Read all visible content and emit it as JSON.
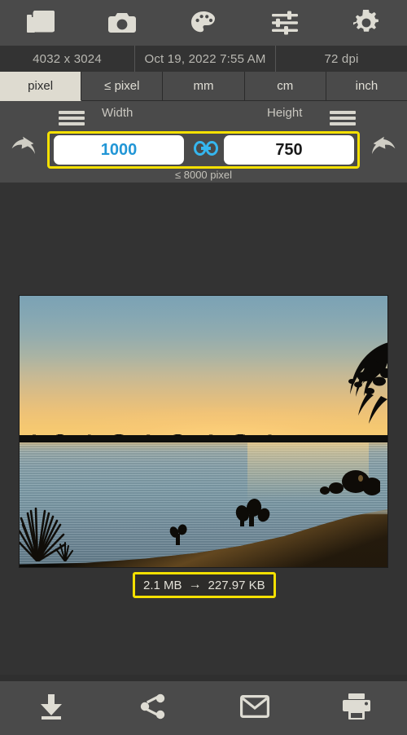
{
  "toolbar": {
    "items": [
      {
        "icon": "gallery-icon",
        "label": "Gallery"
      },
      {
        "icon": "camera-icon",
        "label": "Camera"
      },
      {
        "icon": "palette-icon",
        "label": "Palette"
      },
      {
        "icon": "tune-sliders-icon",
        "label": "Adjust"
      },
      {
        "icon": "gear-icon",
        "label": "Settings"
      }
    ]
  },
  "metadata": {
    "dimensions": "4032 x 3024",
    "date": "Oct 19, 2022 7:55 AM",
    "dpi": "72 dpi"
  },
  "unit_tabs": {
    "selected": "pixel",
    "items": [
      "pixel",
      "≤ pixel",
      "mm",
      "cm",
      "inch"
    ]
  },
  "size_controls": {
    "width_label": "Width",
    "height_label": "Height",
    "width_value": "1000",
    "height_value": "750",
    "width_placeholder": "Width",
    "height_placeholder": "Height",
    "hint": "≤ 8000 pixel",
    "link_icon": "chain-link-icon",
    "undo_icon": "undo-arrow-icon",
    "redo_icon": "redo-arrow-icon",
    "link_color": "#35b6ef",
    "width_value_color": "#2196d6",
    "highlight_color": "#f5e000"
  },
  "preview": {
    "file_size_original": "2.1 MB",
    "file_size_arrow": "→",
    "file_size_new": "227.97 KB"
  },
  "bottom_bar": {
    "items": [
      {
        "icon": "download-icon",
        "label": "Save"
      },
      {
        "icon": "share-icon",
        "label": "Share"
      },
      {
        "icon": "email-icon",
        "label": "Email"
      },
      {
        "icon": "print-icon",
        "label": "Print"
      }
    ]
  }
}
